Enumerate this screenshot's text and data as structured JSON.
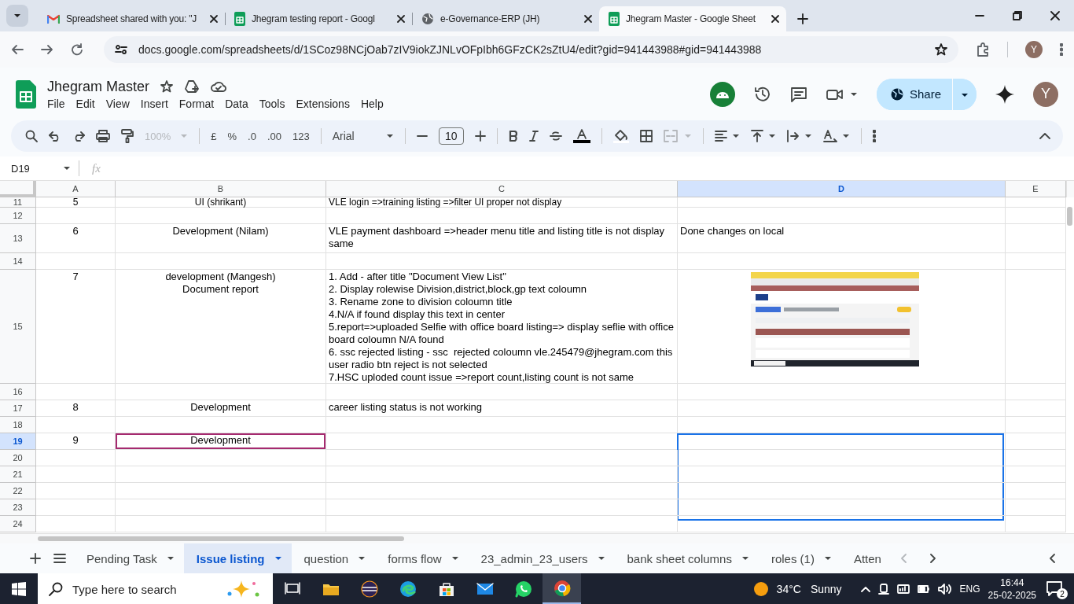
{
  "browser": {
    "tabs": [
      {
        "title": "Spreadsheet shared with you: \"J",
        "kind": "mail",
        "selected": false
      },
      {
        "title": "Jhegram testing report - Googl",
        "kind": "sheets",
        "selected": false
      },
      {
        "title": "e-Governance-ERP (JH)",
        "kind": "web",
        "selected": false
      },
      {
        "title": "Jhegram Master - Google Sheet",
        "kind": "sheets",
        "selected": true
      }
    ],
    "url": "docs.google.com/spreadsheets/d/1SCoz98NCjOab7zIV9iokZJNLvOFpIbh6GFzCK2sZtU4/edit?gid=941443988#gid=941443988",
    "profile": "Y"
  },
  "document": {
    "title": "Jhegram Master",
    "menu": [
      "File",
      "Edit",
      "View",
      "Insert",
      "Format",
      "Data",
      "Tools",
      "Extensions",
      "Help"
    ],
    "share": "Share",
    "avatar": "Y"
  },
  "toolbar": {
    "zoom": "100%",
    "currency": "£",
    "percent": "%",
    "decrease_decimals": ".0",
    "increase_decimals": ".00",
    "number_format": "123",
    "font": "Arial",
    "font_size": "10"
  },
  "formula_bar": {
    "cell": "D19",
    "fx": "fx"
  },
  "grid": {
    "columns": [
      {
        "label": "A",
        "selected": false
      },
      {
        "label": "B",
        "selected": false
      },
      {
        "label": "C",
        "selected": false
      },
      {
        "label": "D",
        "selected": true
      },
      {
        "label": "E",
        "selected": false
      }
    ],
    "rows": [
      {
        "number": "11",
        "selected": false,
        "cells": [
          {
            "text": "5"
          },
          {
            "text": "UI (shrikant)"
          },
          {
            "text": "VLE login =>training listing =>filter UI proper not display"
          },
          {},
          {}
        ]
      },
      {
        "number": "12",
        "selected": false,
        "cells": [
          {},
          {},
          {},
          {},
          {}
        ]
      },
      {
        "number": "13",
        "selected": false,
        "cells": [
          {
            "text": "6"
          },
          {
            "text": "Development (Nilam)"
          },
          {
            "text": "VLE payment dashboard =>header menu title and listing title is not display same"
          },
          {
            "text": "Done changes on local"
          },
          {}
        ]
      },
      {
        "number": "14",
        "selected": false,
        "cells": [
          {},
          {},
          {},
          {},
          {}
        ]
      },
      {
        "number": "15",
        "selected": false,
        "cells": [
          {
            "text": "7"
          },
          {
            "text": "development (Mangesh)\nDocument report"
          },
          {
            "text": "1. Add - after title \"Document View List\"\n2. Display rolewise Division,district,block,gp text coloumn\n3. Rename zone to division coloumn title\n4.N/A if found display this text in center\n5.report=>uploaded Selfie with office board listing=> display seflie with office board coloumn N/A found\n6. ssc rejected listing - ssc  rejected coloumn vle.245479@jhegram.com this user radio btn reject is not selected\n7.HSC uploded count issue =>report count,listing count is not same"
          },
          {
            "kind": "picture"
          },
          {}
        ]
      },
      {
        "number": "16",
        "selected": false,
        "cells": [
          {},
          {},
          {},
          {},
          {}
        ]
      },
      {
        "number": "17",
        "selected": false,
        "cells": [
          {
            "text": "8"
          },
          {
            "text": "Development"
          },
          {
            "text": "career listing status is not working"
          },
          {},
          {}
        ]
      },
      {
        "number": "18",
        "selected": false,
        "cells": [
          {},
          {},
          {},
          {},
          {}
        ]
      },
      {
        "number": "19",
        "selected": true,
        "cells": [
          {
            "text": "9"
          },
          {
            "text": "Development",
            "collaborator": true
          },
          {},
          {},
          {}
        ]
      },
      {
        "number": "20",
        "selected": false,
        "cells": [
          {},
          {},
          {},
          {},
          {}
        ]
      },
      {
        "number": "21",
        "selected": false,
        "cells": [
          {},
          {},
          {},
          {},
          {}
        ]
      },
      {
        "number": "22",
        "selected": false,
        "cells": [
          {},
          {},
          {},
          {},
          {}
        ]
      },
      {
        "number": "23",
        "selected": false,
        "cells": [
          {},
          {},
          {},
          {},
          {}
        ]
      },
      {
        "number": "24",
        "selected": false,
        "cells": [
          {},
          {},
          {},
          {},
          {}
        ]
      }
    ]
  },
  "sheet_tabs": [
    {
      "label": "Pending Task",
      "selected": false
    },
    {
      "label": "Issue listing",
      "selected": true
    },
    {
      "label": "question",
      "selected": false
    },
    {
      "label": "forms flow",
      "selected": false
    },
    {
      "label": "23_admin_23_users",
      "selected": false
    },
    {
      "label": "bank sheet columns",
      "selected": false
    },
    {
      "label": "roles (1)",
      "selected": false
    },
    {
      "label": "Atten",
      "selected": false
    }
  ],
  "taskbar": {
    "search_placeholder": "Type here to search",
    "temperature": "34°C",
    "weather": "Sunny",
    "language": "ENG",
    "time": "16:44",
    "date": "25-02-2025",
    "notifications": "2"
  }
}
